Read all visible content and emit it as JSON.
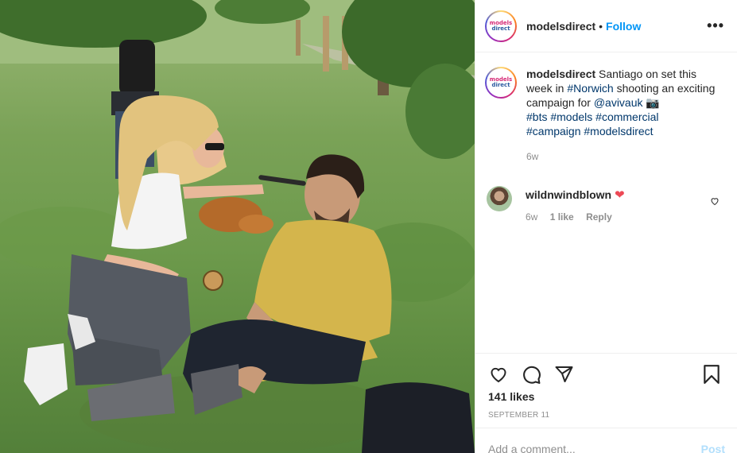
{
  "post": {
    "username": "modelsdirect",
    "follow_label": "Follow",
    "more_label": "•••",
    "avatar_logo": [
      "models",
      "direct"
    ]
  },
  "caption": {
    "username": "modelsdirect",
    "text_1": " Santiago on set this week in ",
    "tag_norwich": "#Norwich",
    "text_2": " shooting an exciting campaign for ",
    "mention": "@avivauk",
    "camera_emoji": "📷",
    "tags_line_1": "#bts #models #commercial",
    "tags_line_2": "#campaign #modelsdirect",
    "time": "6w"
  },
  "comment": {
    "username": "wildnwindblown",
    "emoji": "❤",
    "time": "6w",
    "likes": "1 like",
    "reply": "Reply"
  },
  "footer": {
    "likes": "141 likes",
    "date": "SEPTEMBER 11",
    "add_comment_placeholder": "Add a comment...",
    "post_label": "Post"
  },
  "colors": {
    "link": "#00376b",
    "follow": "#0095f6",
    "heart": "#ed4956",
    "post_disabled": "#b2dffc"
  }
}
